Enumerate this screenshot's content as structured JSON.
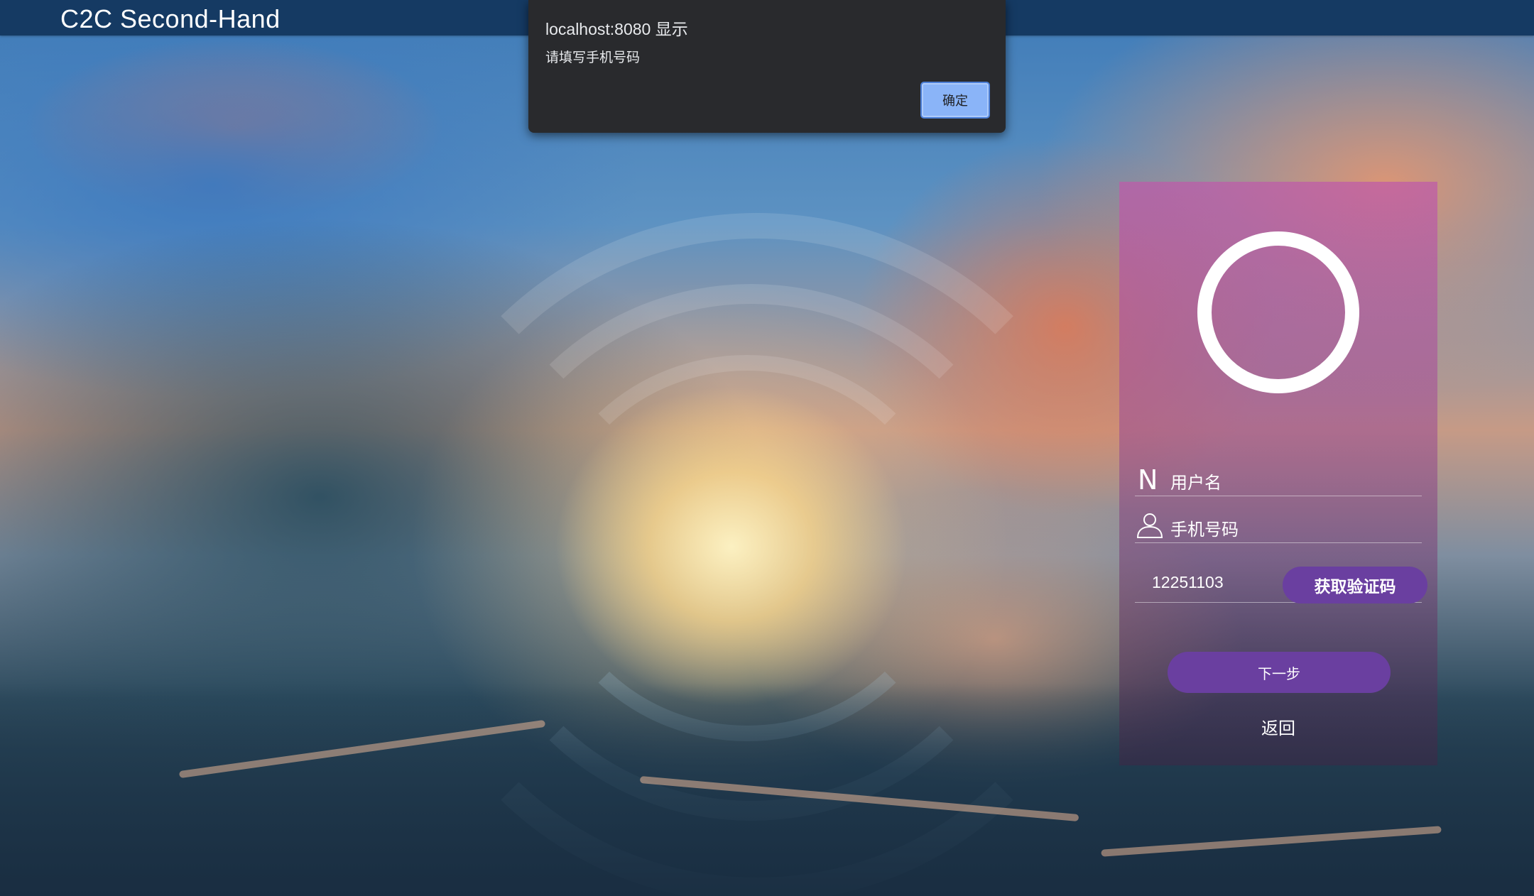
{
  "app": {
    "brand": "C2C Second-Hand"
  },
  "alert": {
    "title": "localhost:8080 显示",
    "message": "请填写手机号码",
    "ok_label": "确定"
  },
  "login_panel": {
    "username": {
      "icon": "n-letter-icon",
      "placeholder": "用户名"
    },
    "phone": {
      "icon": "user-icon",
      "placeholder": "手机号码"
    },
    "verification_code": {
      "value": "12251103",
      "button_label": "获取验证码"
    },
    "next_label": "下一步",
    "back_label": "返回"
  },
  "colors": {
    "navbar": "#153a63",
    "alert_bg": "#292a2d",
    "alert_button": "#8ab4f8",
    "button_purple": "#6a3fa0"
  }
}
